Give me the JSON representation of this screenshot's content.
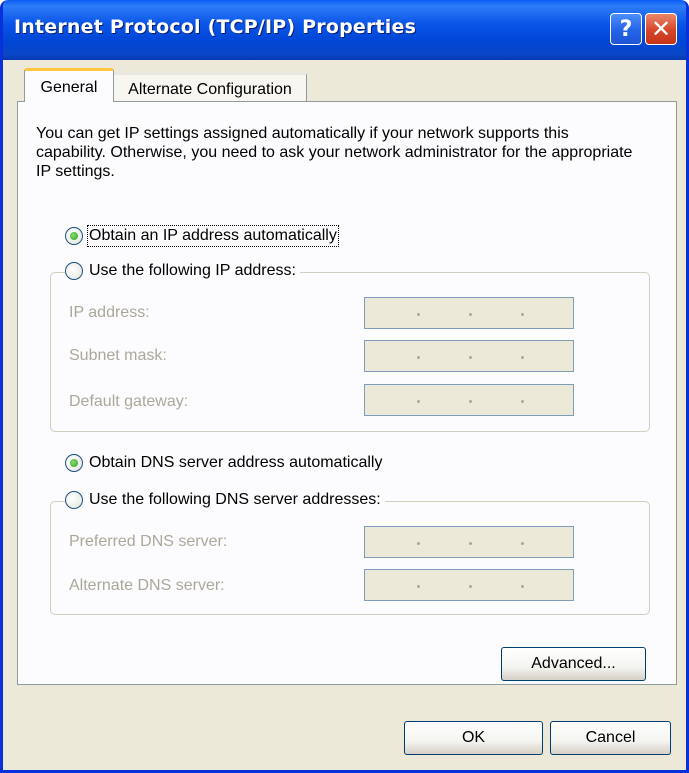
{
  "window": {
    "title": "Internet Protocol (TCP/IP) Properties",
    "help_icon": "?",
    "close_icon": "✕"
  },
  "tabs": [
    {
      "label": "General",
      "active": true
    },
    {
      "label": "Alternate Configuration",
      "active": false
    }
  ],
  "description": "You can get IP settings assigned automatically if your network supports this capability. Otherwise, you need to ask your network administrator for the appropriate IP settings.",
  "ip_section": {
    "auto_option": {
      "label": "Obtain an IP address automatically",
      "selected": true
    },
    "manual_option": {
      "label": "Use the following IP address:",
      "selected": false
    },
    "fields": [
      {
        "label": "IP address:",
        "value": ". . ."
      },
      {
        "label": "Subnet mask:",
        "value": ". . ."
      },
      {
        "label": "Default gateway:",
        "value": ". . ."
      }
    ]
  },
  "dns_section": {
    "auto_option": {
      "label": "Obtain DNS server address automatically",
      "selected": true
    },
    "manual_option": {
      "label": "Use the following DNS server addresses:",
      "selected": false
    },
    "fields": [
      {
        "label": "Preferred DNS server:",
        "value": ". . ."
      },
      {
        "label": "Alternate DNS server:",
        "value": ". . ."
      }
    ]
  },
  "buttons": {
    "advanced": "Advanced...",
    "ok": "OK",
    "cancel": "Cancel"
  },
  "colors": {
    "titlebar": "#0054e3",
    "dialog_bg": "#ece9d8",
    "panel_bg": "#fcfcfe",
    "disabled_text": "#aca899",
    "radio_selected": "#21a121",
    "tab_highlight": "#ffc83c"
  }
}
